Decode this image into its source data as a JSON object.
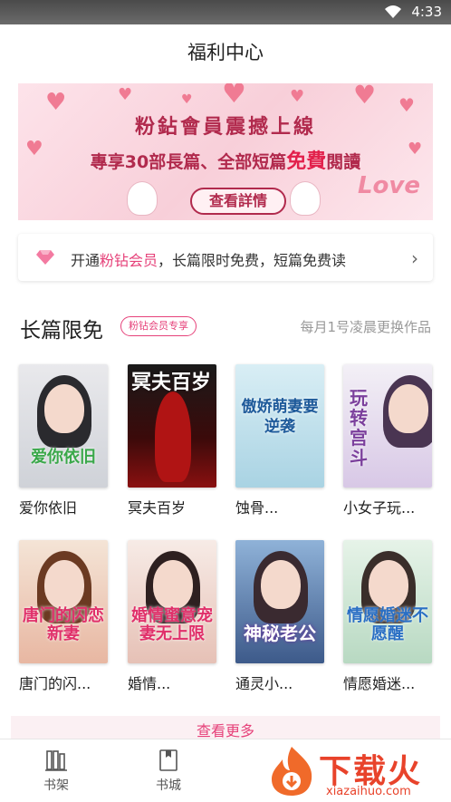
{
  "status_bar": {
    "time": "4:33"
  },
  "header": {
    "title": "福利中心"
  },
  "banner": {
    "line1": "粉鉆會員震撼上線",
    "line2_pre": "專享30部長篇、全部短篇",
    "line2_em": "免費",
    "line2_post": "閱讀",
    "cta": "查看詳情",
    "love": "Love"
  },
  "vip_promo": {
    "pre": "开通",
    "highlight": "粉钻会员",
    "post": "，长篇限时免费，短篇免费读",
    "chevron": "›"
  },
  "section": {
    "title": "长篇限免",
    "badge": "粉钻会员专享",
    "note": "每月1号凌晨更换作品"
  },
  "books": [
    {
      "name": "爱你依旧",
      "cover_title": "爱你依旧"
    },
    {
      "name": "冥夫百岁",
      "cover_title": "冥夫百岁"
    },
    {
      "name": "蚀骨...",
      "cover_title": "傲娇萌妻要逆袭"
    },
    {
      "name": "小女子玩...",
      "cover_title": "玩转宫斗"
    },
    {
      "name": "唐门的闪...",
      "cover_title": "唐门的闪恋新妻"
    },
    {
      "name": "婚情...",
      "cover_title": "婚情蜜意宠妻无上限"
    },
    {
      "name": "通灵小...",
      "cover_title": "神秘老公"
    },
    {
      "name": "情愿婚迷...",
      "cover_title": "情愿婚迷不愿醒"
    }
  ],
  "more_button": "查看更多",
  "tabs": [
    {
      "label": "书架",
      "icon": "bookshelf-icon"
    },
    {
      "label": "书城",
      "icon": "bookstore-icon"
    }
  ],
  "watermark": {
    "text": "下载火",
    "url": "xiazaihuo.com"
  },
  "colors": {
    "accent": "#e6427a",
    "banner_text": "#b12a4d",
    "watermark": "#e8432b"
  }
}
